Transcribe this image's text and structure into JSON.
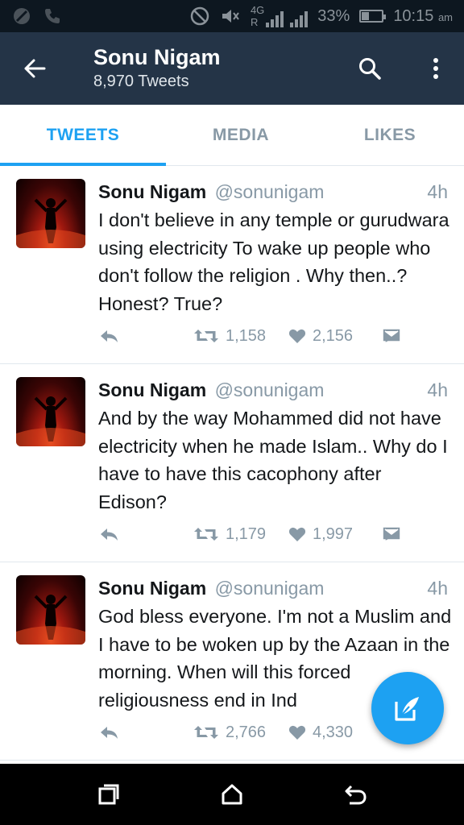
{
  "status_bar": {
    "network_label": "4G",
    "roaming_label": "R",
    "battery": "33%",
    "time": "10:15",
    "ampm": "am",
    "icons": [
      "no-disturb-icon",
      "call-icon",
      "do-not-disturb-icon",
      "mute-icon",
      "signal-icon",
      "battery-icon"
    ]
  },
  "header": {
    "title": "Sonu Nigam",
    "subtitle": "8,970 Tweets",
    "icons": [
      "back-arrow-icon",
      "search-icon",
      "more-vert-icon"
    ]
  },
  "tabs": [
    {
      "label": "TWEETS",
      "active": true
    },
    {
      "label": "MEDIA",
      "active": false
    },
    {
      "label": "LIKES",
      "active": false
    }
  ],
  "tweets": [
    {
      "name": "Sonu Nigam",
      "handle": "@sonunigam",
      "time": "4h",
      "text": "I don't believe in any temple or gurudwara using electricity To wake up people who don't follow the religion . Why then..? Honest? True?",
      "retweets": "1,158",
      "likes": "2,156"
    },
    {
      "name": "Sonu Nigam",
      "handle": "@sonunigam",
      "time": "4h",
      "text": "And by the way Mohammed did not have electricity when he made Islam.. Why do I have to have this cacophony after Edison?",
      "retweets": "1,179",
      "likes": "1,997"
    },
    {
      "name": "Sonu Nigam",
      "handle": "@sonunigam",
      "time": "4h",
      "text": "God bless everyone. I'm not a Muslim and I have to be woken up by the Azaan in the morning. When will this forced religiousness end in Ind",
      "retweets": "2,766",
      "likes": "4,330"
    }
  ],
  "colors": {
    "accent": "#1da1f2",
    "appbar": "#243447",
    "statusbar": "#0d1720",
    "muted": "#8899a6",
    "text": "#14171a"
  }
}
